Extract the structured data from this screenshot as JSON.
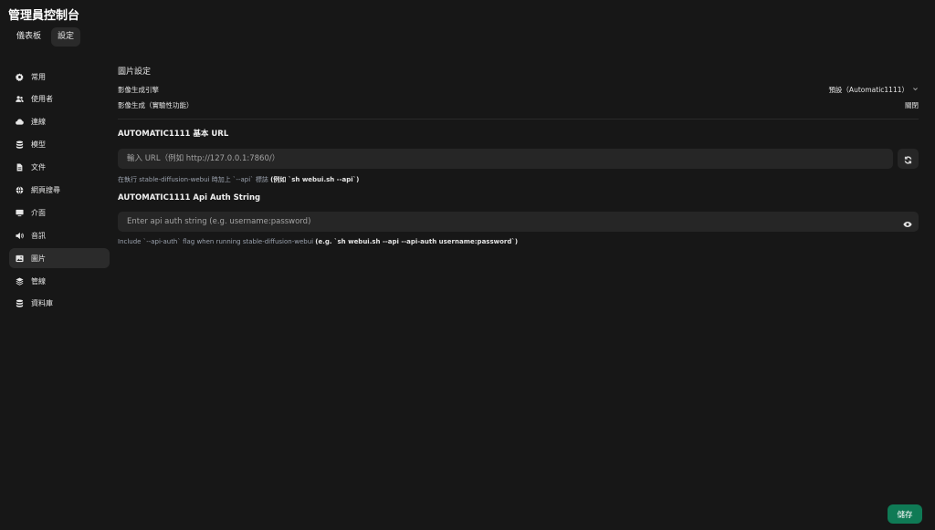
{
  "app": {
    "title": "管理員控制台"
  },
  "top_tabs": [
    {
      "label": "儀表板"
    },
    {
      "label": "設定"
    }
  ],
  "sidebar": {
    "items": [
      {
        "label": "常用",
        "icon": "gear-icon"
      },
      {
        "label": "使用者",
        "icon": "users-icon"
      },
      {
        "label": "連線",
        "icon": "cloud-icon"
      },
      {
        "label": "模型",
        "icon": "cube-stack-icon"
      },
      {
        "label": "文件",
        "icon": "document-icon"
      },
      {
        "label": "網頁搜尋",
        "icon": "globe-icon"
      },
      {
        "label": "介面",
        "icon": "monitor-icon"
      },
      {
        "label": "音訊",
        "icon": "speaker-icon"
      },
      {
        "label": "圖片",
        "icon": "image-icon"
      },
      {
        "label": "管線",
        "icon": "layers-icon"
      },
      {
        "label": "資料庫",
        "icon": "database-icon"
      }
    ],
    "active_index": 8
  },
  "image_settings": {
    "title": "圖片設定",
    "engine_label": "影像生成引擎",
    "engine_value": "預設（Automatic1111）",
    "generation_label": "影像生成（實驗性功能）",
    "generation_value": "關閉"
  },
  "base_url": {
    "label": "AUTOMATIC1111 基本 URL",
    "placeholder": "輸入 URL（例如 http://127.0.0.1:7860/）",
    "value": "",
    "hint_prefix": "在執行 stable-diffusion-webui 時加上 `--api` 標誌 ",
    "hint_bold": "(例如 `sh webui.sh --api`)"
  },
  "api_auth": {
    "label": "AUTOMATIC1111 Api Auth String",
    "placeholder": "Enter api auth string (e.g. username:password)",
    "value": "",
    "hint_prefix": "Include `--api-auth` flag when running stable-diffusion-webui ",
    "hint_bold": "(e.g. `sh webui.sh --api --api-auth username:password`)"
  },
  "actions": {
    "save_label": "儲存"
  },
  "colors": {
    "background": "#171717",
    "accent": "#0f7a55"
  }
}
